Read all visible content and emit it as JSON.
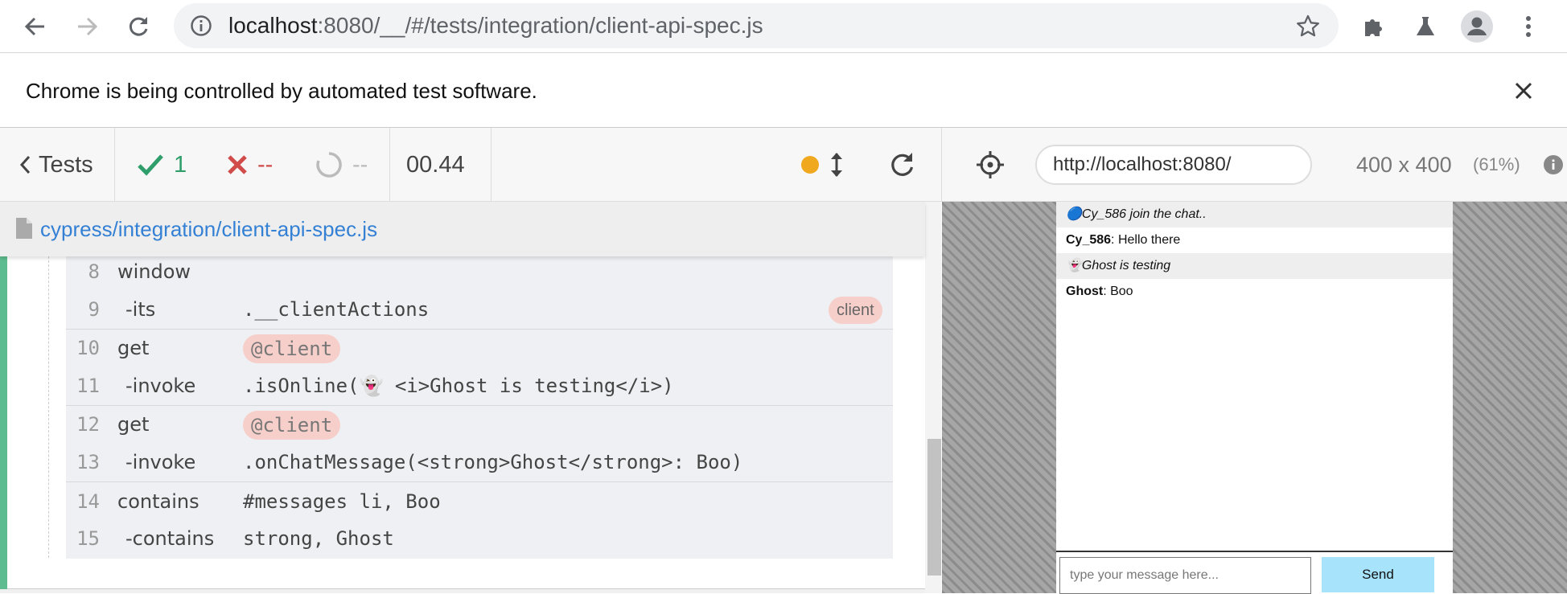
{
  "browser": {
    "url_host": "localhost",
    "url_rest": ":8080/__/#/tests/integration/client-api-spec.js",
    "back_icon": "arrow-left-icon",
    "forward_icon": "arrow-right-icon",
    "reload_icon": "reload-icon",
    "info_icon": "info-icon",
    "star_icon": "star-icon",
    "extensions_icon": "puzzle-icon",
    "labs_icon": "flask-icon",
    "profile_icon": "avatar-icon",
    "menu_icon": "kebab-menu-icon"
  },
  "banner": {
    "text": "Chrome is being controlled by automated test software.",
    "close_icon": "close-icon"
  },
  "reporter": {
    "tests_label": "Tests",
    "passed_count": "1",
    "failed_count": "--",
    "pending_count": "--",
    "duration": "00.44",
    "spec_path": "cypress/integration/client-api-spec.js"
  },
  "aut_header": {
    "url": "http://localhost:8080/",
    "viewport": "400 x 400",
    "scale": "(61%)"
  },
  "commands": [
    {
      "num": "8",
      "name": "window",
      "message": "",
      "badge": ""
    },
    {
      "num": "9",
      "name": "-its",
      "message": ".__clientActions",
      "badge": "client"
    },
    {
      "num": "10",
      "name": "get",
      "message": "@client",
      "badge": ""
    },
    {
      "num": "11",
      "name": "-invoke",
      "message": ".isOnline(👻 <i>Ghost is testing</i>)",
      "badge": ""
    },
    {
      "num": "12",
      "name": "get",
      "message": "@client",
      "badge": ""
    },
    {
      "num": "13",
      "name": "-invoke",
      "message": ".onChatMessage(<strong>Ghost</strong>: Boo)",
      "badge": ""
    },
    {
      "num": "14",
      "name": "contains",
      "message": "#messages li, Boo",
      "badge": ""
    },
    {
      "num": "15",
      "name": "-contains",
      "message": "strong, Ghost",
      "badge": ""
    }
  ],
  "chat": {
    "messages": [
      {
        "author": "",
        "icon": "🔵",
        "text": "Cy_586 join the chat..",
        "italic": true
      },
      {
        "author": "Cy_586",
        "icon": "",
        "text": ": Hello there",
        "italic": false
      },
      {
        "author": "",
        "icon": "👻",
        "text": "Ghost is testing",
        "italic": true
      },
      {
        "author": "Ghost",
        "icon": "",
        "text": ": Boo",
        "italic": false
      }
    ],
    "input_placeholder": "type your message here...",
    "send_label": "Send"
  },
  "colors": {
    "pass": "#2f9e6b",
    "fail": "#d14b4b",
    "link": "#3380d4",
    "running_dot": "#f0a81e",
    "send_button": "#a7e3fb"
  }
}
